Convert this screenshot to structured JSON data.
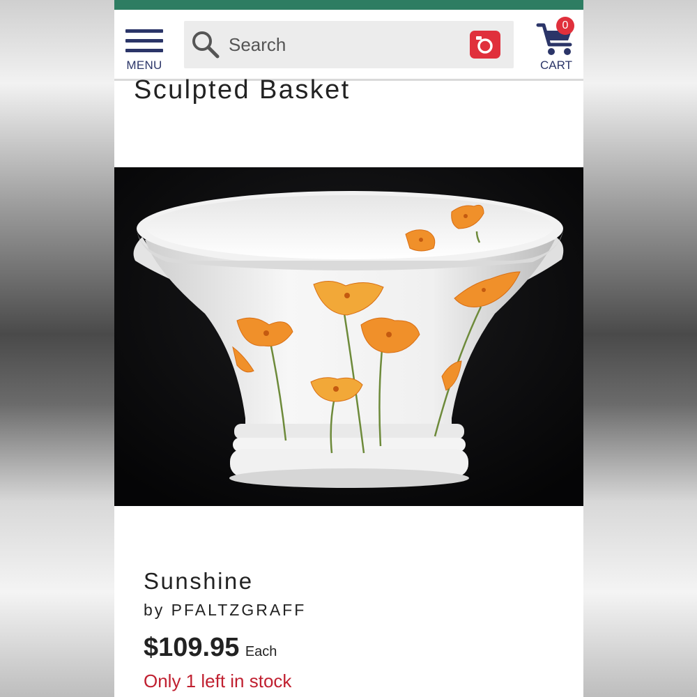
{
  "header": {
    "menu_label": "MENU",
    "search_placeholder": "Search",
    "cart_label": "CART",
    "cart_count": "0",
    "accent_color": "#2e7d62",
    "brand_color": "#2b3568",
    "camera_color": "#e0303c"
  },
  "product": {
    "title_partial": "Sculpted Basket",
    "pattern": "Sunshine",
    "brand": "by PFALTZGRAFF",
    "price": "$109.95",
    "price_unit": "Each",
    "stock_message": "Only 1 left in stock",
    "stock_color": "#c02030"
  },
  "icons": {
    "menu": "hamburger-menu-icon",
    "search": "magnifier-icon",
    "camera": "camera-icon",
    "cart": "shopping-cart-icon"
  }
}
